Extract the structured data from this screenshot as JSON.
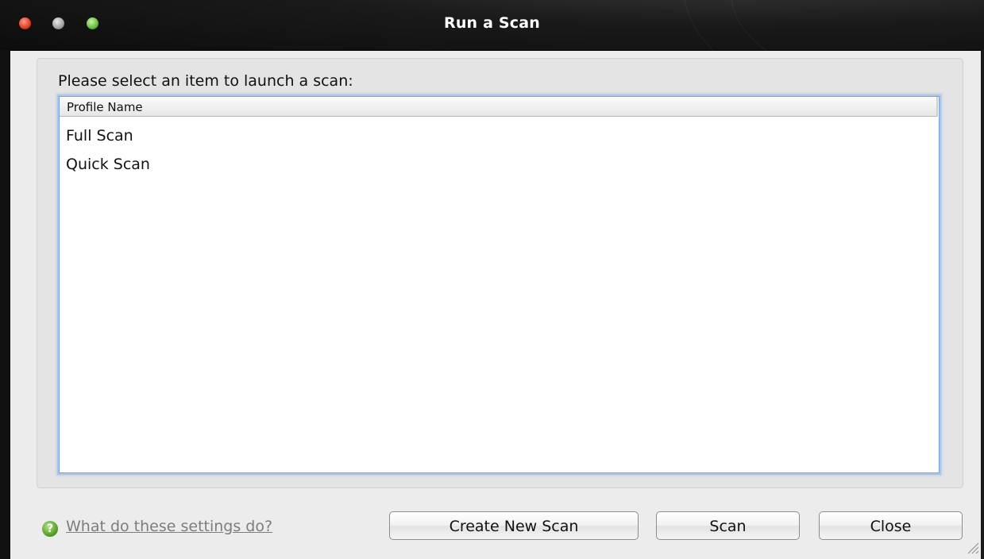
{
  "window": {
    "title": "Run a Scan"
  },
  "prompt": "Please select an item to launch a scan:",
  "list": {
    "column_header": "Profile Name",
    "items": [
      {
        "label": "Full Scan"
      },
      {
        "label": "Quick Scan"
      }
    ]
  },
  "footer": {
    "help_link": "What do these settings do?",
    "create_button": "Create New Scan",
    "scan_button": "Scan",
    "close_button": "Close"
  },
  "icons": {
    "help": "question-mark-icon"
  },
  "colors": {
    "titlebar": "#111111",
    "window_bg": "#ececec",
    "list_focus_ring": "#7aa2d6",
    "help_icon": "#5fa832",
    "link_text": "#7d7d7d"
  }
}
